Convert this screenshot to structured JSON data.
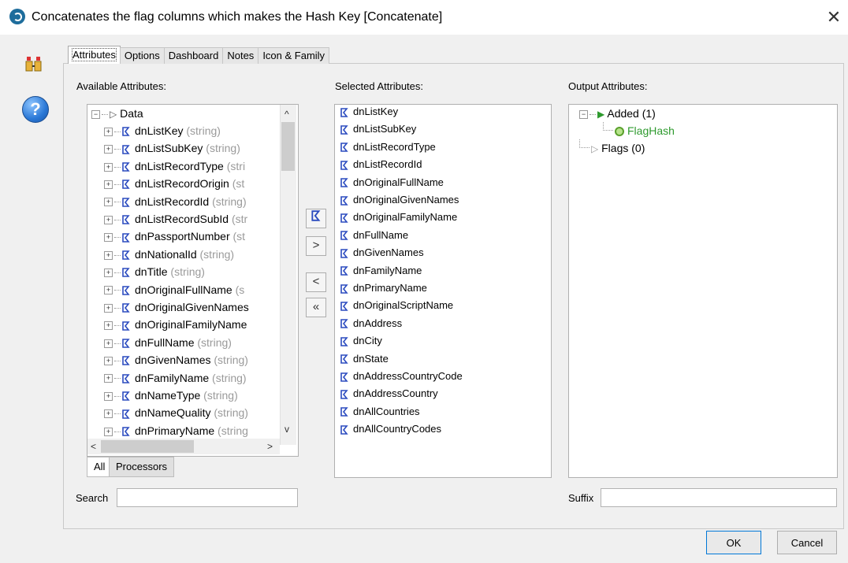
{
  "window": {
    "title": "Concatenates the flag columns which makes the Hash Key [Concatenate]",
    "close_label": "✕"
  },
  "tabs": [
    "Attributes",
    "Options",
    "Dashboard",
    "Notes",
    "Icon & Family"
  ],
  "active_tab": 0,
  "available": {
    "label": "Available Attributes:",
    "root": "Data",
    "items": [
      {
        "name": "dnListKey",
        "type": "(string)"
      },
      {
        "name": "dnListSubKey",
        "type": "(string)"
      },
      {
        "name": "dnListRecordType",
        "type": "(stri"
      },
      {
        "name": "dnListRecordOrigin",
        "type": "(st"
      },
      {
        "name": "dnListRecordId",
        "type": "(string)"
      },
      {
        "name": "dnListRecordSubId",
        "type": "(str"
      },
      {
        "name": "dnPassportNumber",
        "type": "(st"
      },
      {
        "name": "dnNationalId",
        "type": "(string)"
      },
      {
        "name": "dnTitle",
        "type": "(string)"
      },
      {
        "name": "dnOriginalFullName",
        "type": "(s"
      },
      {
        "name": "dnOriginalGivenNames",
        "type": ""
      },
      {
        "name": "dnOriginalFamilyName",
        "type": ""
      },
      {
        "name": "dnFullName",
        "type": "(string)"
      },
      {
        "name": "dnGivenNames",
        "type": "(string)"
      },
      {
        "name": "dnFamilyName",
        "type": "(string)"
      },
      {
        "name": "dnNameType",
        "type": "(string)"
      },
      {
        "name": "dnNameQuality",
        "type": "(string)"
      },
      {
        "name": "dnPrimaryName",
        "type": "(string"
      }
    ],
    "subtabs": [
      "All",
      "Processors"
    ]
  },
  "selected": {
    "label": "Selected Attributes:",
    "items": [
      "dnListKey",
      "dnListSubKey",
      "dnListRecordType",
      "dnListRecordId",
      "dnOriginalFullName",
      "dnOriginalGivenNames",
      "dnOriginalFamilyName",
      "dnFullName",
      "dnGivenNames",
      "dnFamilyName",
      "dnPrimaryName",
      "dnOriginalScriptName",
      "dnAddress",
      "dnCity",
      "dnState",
      "dnAddressCountryCode",
      "dnAddressCountry",
      "dnAllCountries",
      "dnAllCountryCodes"
    ]
  },
  "output": {
    "label": "Output Attributes:",
    "added": "Added (1)",
    "added_child": "FlagHash",
    "flags": "Flags (0)"
  },
  "buttons_mid": {
    "add": ">",
    "remove": "<",
    "remove_all": "«"
  },
  "search_label": "Search",
  "suffix_label": "Suffix",
  "ok": "OK",
  "cancel": "Cancel",
  "colors": {
    "added_child": "#2e9a2e",
    "attr_icon": "#2b4bbf"
  }
}
